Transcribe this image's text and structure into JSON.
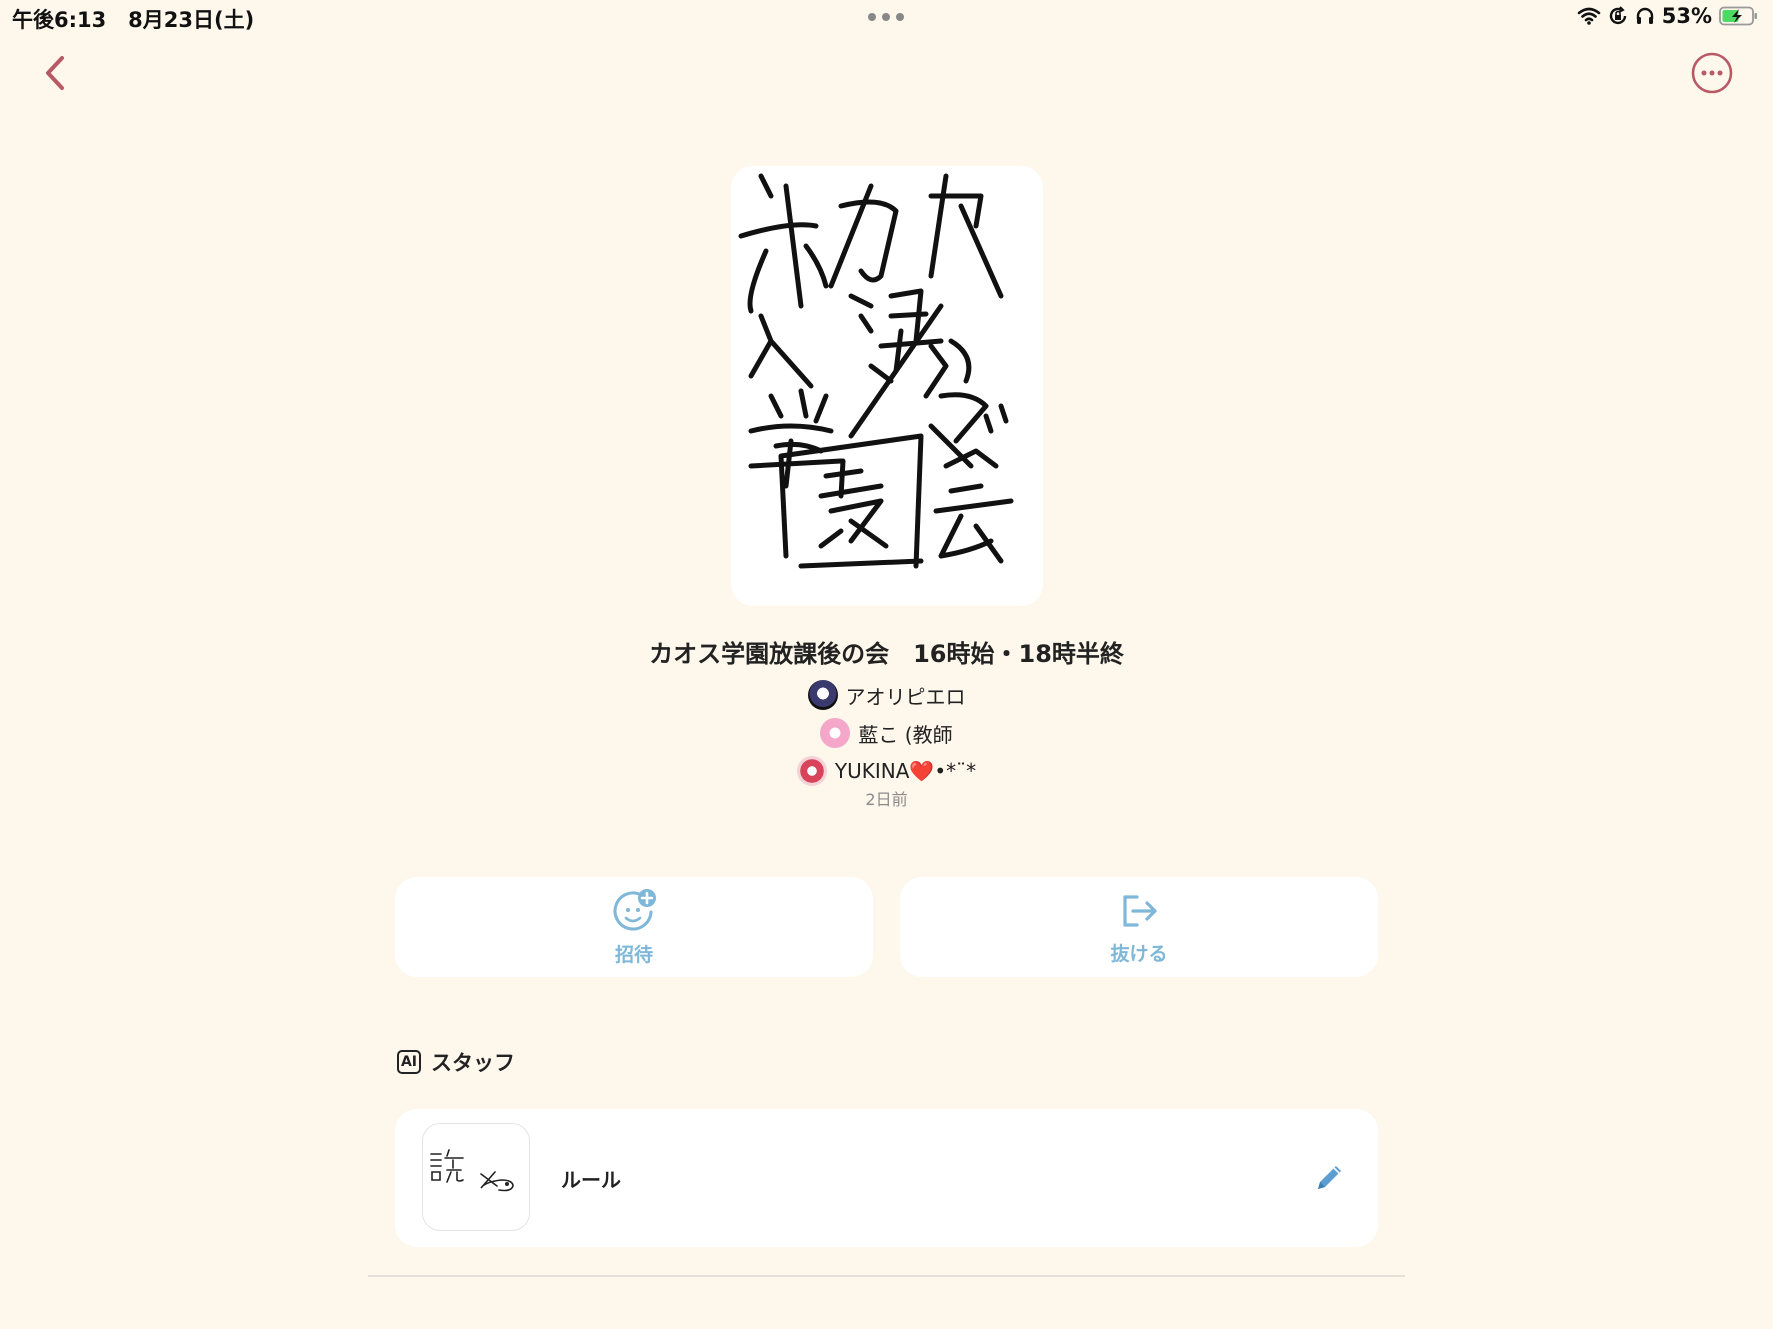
{
  "status_bar": {
    "time": "午後6:13",
    "date": "8月23日(土)",
    "battery": "53%",
    "icons": [
      "multitasking-dots-icon",
      "wifi-icon",
      "orientation-lock-icon",
      "headphones-icon",
      "battery-charging-icon"
    ]
  },
  "nav": {
    "back_icon": "chevron-left-icon",
    "more_icon": "ellipsis-circle-icon",
    "accent": "#b85a66"
  },
  "group": {
    "title": "カオス学園放課後の会　16時始・18時半終",
    "members": [
      {
        "name": "アオリピエロ"
      },
      {
        "name": "藍こ (教師"
      },
      {
        "name": "YUKINA",
        "suffix_heart": "❤️",
        "suffix": "•*¨*"
      }
    ],
    "updated": "2日前"
  },
  "actions": {
    "invite": {
      "label": "招待",
      "icon": "add-person-icon"
    },
    "leave": {
      "label": "抜ける",
      "icon": "exit-icon"
    },
    "color": "#7eb7d8"
  },
  "staff": {
    "badge": "AI",
    "title": "スタッフ",
    "items": [
      {
        "name": "ルール",
        "icon": "pencil-icon"
      }
    ]
  }
}
